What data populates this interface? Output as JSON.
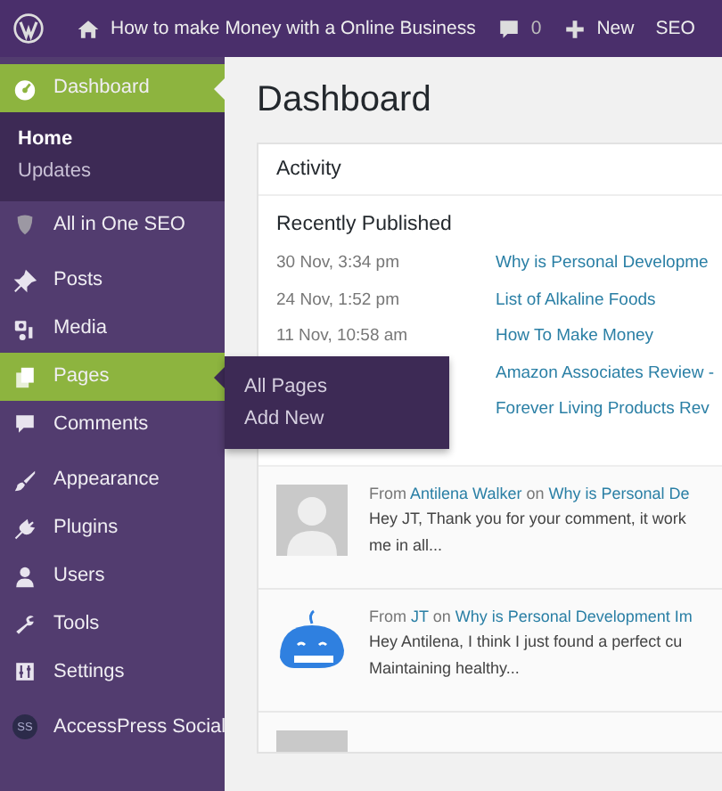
{
  "top_bar": {
    "site_title": "How to make Money with a Online Business",
    "comments_count": "0",
    "new_label": "New",
    "seo_label": "SEO"
  },
  "sidebar": {
    "groups": [
      [
        {
          "label": "Dashboard",
          "kind": "gauge",
          "selected": true,
          "submenu": [
            {
              "label": "Home",
              "selected": true
            },
            {
              "label": "Updates",
              "selected": false
            }
          ]
        },
        {
          "label": "All in One SEO",
          "kind": "shield",
          "selected": false
        }
      ],
      [
        {
          "label": "Posts",
          "kind": "pin",
          "selected": false
        },
        {
          "label": "Media",
          "kind": "media",
          "selected": false
        },
        {
          "label": "Pages",
          "kind": "pages",
          "selected": true,
          "flyout": [
            {
              "label": "All Pages"
            },
            {
              "label": "Add New"
            }
          ]
        },
        {
          "label": "Comments",
          "kind": "bubble",
          "selected": false
        }
      ],
      [
        {
          "label": "Appearance",
          "kind": "brush",
          "selected": false
        },
        {
          "label": "Plugins",
          "kind": "plug",
          "selected": false
        },
        {
          "label": "Users",
          "kind": "user",
          "selected": false
        },
        {
          "label": "Tools",
          "kind": "wrench",
          "selected": false
        },
        {
          "label": "Settings",
          "kind": "sliders",
          "selected": false
        }
      ],
      [
        {
          "label": "AccessPress Social",
          "kind": "badge",
          "badge_text": "SS",
          "selected": false
        }
      ]
    ]
  },
  "page_title": "Dashboard",
  "activity": {
    "title": "Activity",
    "section_title": "Recently Published",
    "posts": [
      {
        "date": "30 Nov, 3:34 pm",
        "title": "Why is Personal Developme"
      },
      {
        "date": "24 Nov, 1:52 pm",
        "title": "List of Alkaline Foods"
      },
      {
        "date": "11 Nov, 10:58 am",
        "title": "How To Make Money"
      },
      {
        "title": "Amazon Associates Review -"
      },
      {
        "title": "Forever Living Products Rev"
      }
    ],
    "comments": [
      {
        "kind": "default",
        "from": "From",
        "author": "Antilena Walker",
        "on": "on",
        "post": "Why is Personal De",
        "lines": [
          "Hey JT, Thank you for your comment, it work",
          "me in all..."
        ]
      },
      {
        "kind": "whale",
        "from": "From",
        "author": "JT",
        "on": "on",
        "post": "Why is Personal Development Im",
        "lines": [
          "Hey Antilena, I think I just found a perfect cu",
          "Maintaining healthy..."
        ]
      }
    ]
  }
}
